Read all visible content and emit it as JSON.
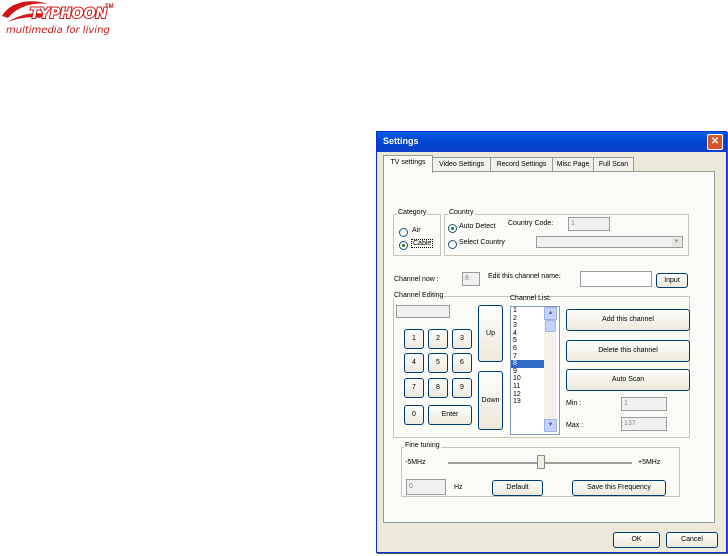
{
  "logo": {
    "brand": "TYPHOON",
    "trademark": "TM",
    "tagline": "multimedia for living"
  },
  "dialog": {
    "title": "Settings",
    "tabs": [
      "TV settings",
      "Video Settings",
      "Record Settings",
      "Misc Page",
      "Full Scan"
    ],
    "category": {
      "label": "Category",
      "options": [
        "Air",
        "Cable"
      ],
      "selected": "Cable"
    },
    "country": {
      "label": "Country",
      "auto_detect": "Auto Detect",
      "select_country": "Select Country",
      "country_code_label": "Country Code:",
      "country_code_value": "1",
      "selected": "Auto Detect"
    },
    "channel_now_label": "Channel now :",
    "channel_now_value": "8",
    "edit_name_label": "Edit this channel name:",
    "edit_name_value": "",
    "input_button": "Input",
    "channel_editing": {
      "label": "Channel Editing",
      "display_value": "",
      "keys": [
        "1",
        "2",
        "3",
        "4",
        "5",
        "6",
        "7",
        "8",
        "9",
        "0"
      ],
      "enter": "Enter",
      "up": "Up",
      "down": "Down"
    },
    "channel_list": {
      "label": "Channel List:",
      "items": [
        "1",
        "2",
        "3",
        "4",
        "5",
        "6",
        "7",
        "8",
        "9",
        "10",
        "11",
        "12",
        "13"
      ],
      "selected": "8"
    },
    "add_channel": "Add this channel",
    "delete_channel": "Delete this channel",
    "auto_scan": "Auto Scan",
    "min_label": "Min :",
    "min_value": "1",
    "max_label": "Max :",
    "max_value": "137",
    "fine_tuning": {
      "label": "Fine tuning",
      "min_label": "-5MHz",
      "max_label": "+5MHz",
      "value": 0,
      "hz_value": "0",
      "hz_unit": "Hz",
      "default_button": "Default",
      "save_button": "Save this Frequency"
    },
    "ok_button": "OK",
    "cancel_button": "Cancel",
    "close_icon": "close-icon"
  },
  "colors": {
    "titlebar": "#0046d5",
    "selection": "#316ac5",
    "brand_red": "#d01818"
  }
}
